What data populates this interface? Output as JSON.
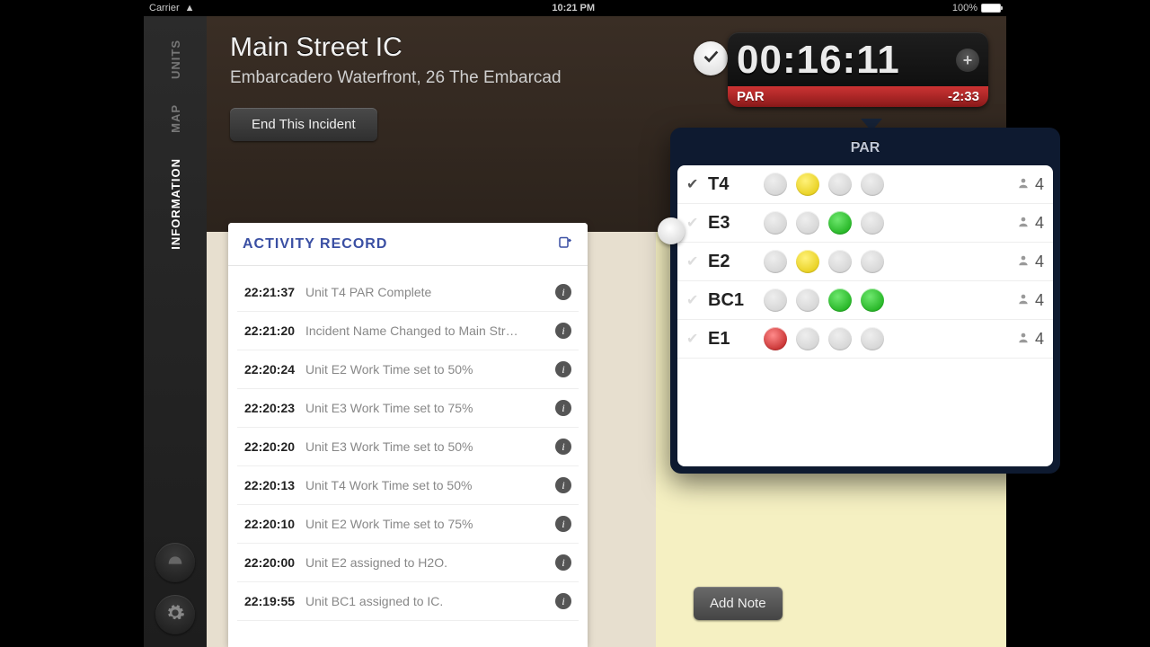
{
  "statusbar": {
    "carrier": "Carrier",
    "time": "10:21 PM",
    "battery": "100%"
  },
  "sidebar": {
    "tabs": {
      "units": "UNITS",
      "map": "MAP",
      "info": "INFORMATION"
    }
  },
  "header": {
    "title": "Main Street IC",
    "subtitle": "Embarcadero Waterfront, 26 The Embarcad",
    "end_button": "End This Incident",
    "timer": "00:16:11",
    "par_label": "PAR",
    "par_time": "-2:33"
  },
  "activity": {
    "title": "ACTIVITY RECORD",
    "rows": [
      {
        "time": "22:21:37",
        "text": "Unit T4 PAR Complete"
      },
      {
        "time": "22:21:20",
        "text": "Incident Name Changed to Main Str…"
      },
      {
        "time": "22:20:24",
        "text": "Unit E2 Work Time set to 50%"
      },
      {
        "time": "22:20:23",
        "text": "Unit E3 Work Time set to 75%"
      },
      {
        "time": "22:20:20",
        "text": "Unit E3 Work Time set to 50%"
      },
      {
        "time": "22:20:13",
        "text": "Unit T4 Work Time set to 50%"
      },
      {
        "time": "22:20:10",
        "text": "Unit E2 Work Time set to 75%"
      },
      {
        "time": "22:20:00",
        "text": "Unit E2 assigned to H2O."
      },
      {
        "time": "22:19:55",
        "text": "Unit BC1 assigned to IC."
      }
    ]
  },
  "par_popover": {
    "title": "PAR",
    "units": [
      {
        "name": "T4",
        "checked": true,
        "dots": [
          "gray",
          "yellow",
          "gray",
          "gray"
        ],
        "count": "4"
      },
      {
        "name": "E3",
        "checked": false,
        "dots": [
          "gray",
          "gray",
          "green",
          "gray"
        ],
        "count": "4"
      },
      {
        "name": "E2",
        "checked": false,
        "dots": [
          "gray",
          "yellow",
          "gray",
          "gray"
        ],
        "count": "4"
      },
      {
        "name": "BC1",
        "checked": false,
        "dots": [
          "gray",
          "gray",
          "green",
          "green"
        ],
        "count": "4"
      },
      {
        "name": "E1",
        "checked": false,
        "dots": [
          "red",
          "gray",
          "gray",
          "gray"
        ],
        "count": "4"
      }
    ]
  },
  "notes": {
    "add_button": "Add Note"
  }
}
